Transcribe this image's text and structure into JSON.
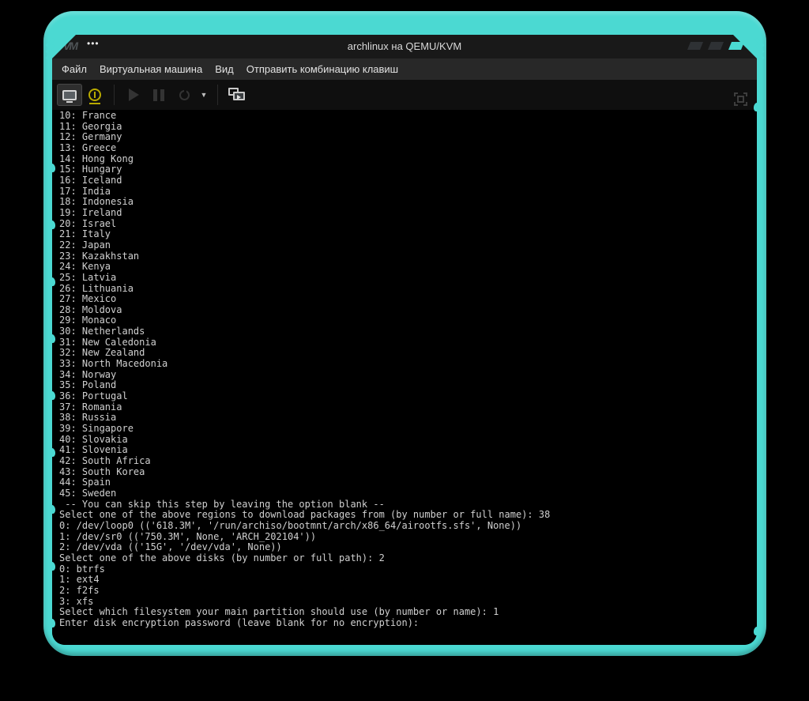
{
  "window": {
    "title": "archlinux на QEMU/KVM",
    "logo_text": "VM",
    "logo_dots": "•••",
    "window_buttons": [
      {
        "name": "minimize",
        "color": "#2e3134"
      },
      {
        "name": "maximize",
        "color": "#2e3134"
      },
      {
        "name": "close",
        "color": "#4bd9d2"
      }
    ]
  },
  "menubar": {
    "items": [
      "Файл",
      "Виртуальная машина",
      "Вид",
      "Отправить комбинацию клавиш"
    ]
  },
  "toolbar": {
    "buttons": [
      {
        "icon": "console-monitor-icon",
        "state": "active"
      },
      {
        "icon": "lightbulb-details-icon",
        "state": "enabled"
      },
      {
        "icon": "play-icon",
        "state": "disabled"
      },
      {
        "icon": "pause-icon",
        "state": "disabled"
      },
      {
        "icon": "power-icon",
        "state": "disabled"
      },
      {
        "icon": "chevron-down-icon",
        "state": "enabled"
      },
      {
        "icon": "displays-icon",
        "state": "enabled"
      },
      {
        "icon": "fullscreen-icon",
        "state": "disabled"
      }
    ],
    "caret_glyph": "▼"
  },
  "terminal": {
    "lines": [
      "10: France",
      "11: Georgia",
      "12: Germany",
      "13: Greece",
      "14: Hong Kong",
      "15: Hungary",
      "16: Iceland",
      "17: India",
      "18: Indonesia",
      "19: Ireland",
      "20: Israel",
      "21: Italy",
      "22: Japan",
      "23: Kazakhstan",
      "24: Kenya",
      "25: Latvia",
      "26: Lithuania",
      "27: Mexico",
      "28: Moldova",
      "29: Monaco",
      "30: Netherlands",
      "31: New Caledonia",
      "32: New Zealand",
      "33: North Macedonia",
      "34: Norway",
      "35: Poland",
      "36: Portugal",
      "37: Romania",
      "38: Russia",
      "39: Singapore",
      "40: Slovakia",
      "41: Slovenia",
      "42: South Africa",
      "43: South Korea",
      "44: Spain",
      "45: Sweden",
      " -- You can skip this step by leaving the option blank --",
      "Select one of the above regions to download packages from (by number or full name): 38",
      "0: /dev/loop0 (('618.3M', '/run/archiso/bootmnt/arch/x86_64/airootfs.sfs', None))",
      "1: /dev/sr0 (('750.3M', None, 'ARCH_202104'))",
      "2: /dev/vda (('15G', '/dev/vda', None))",
      "Select one of the above disks (by number or full path): 2",
      "0: btrfs",
      "1: ext4",
      "2: f2fs",
      "3: xfs",
      "Select which filesystem your main partition should use (by number or name): 1",
      "Enter disk encryption password (leave blank for no encryption):"
    ]
  },
  "colors": {
    "frame_accent": "#4bd9d2",
    "details_icon_yellow": "#b9aa00",
    "terminal_text": "#d0d0d0",
    "titlebar_bg": "#191919",
    "menubar_bg": "#282828",
    "toolbar_bg": "#0f0f0f"
  }
}
